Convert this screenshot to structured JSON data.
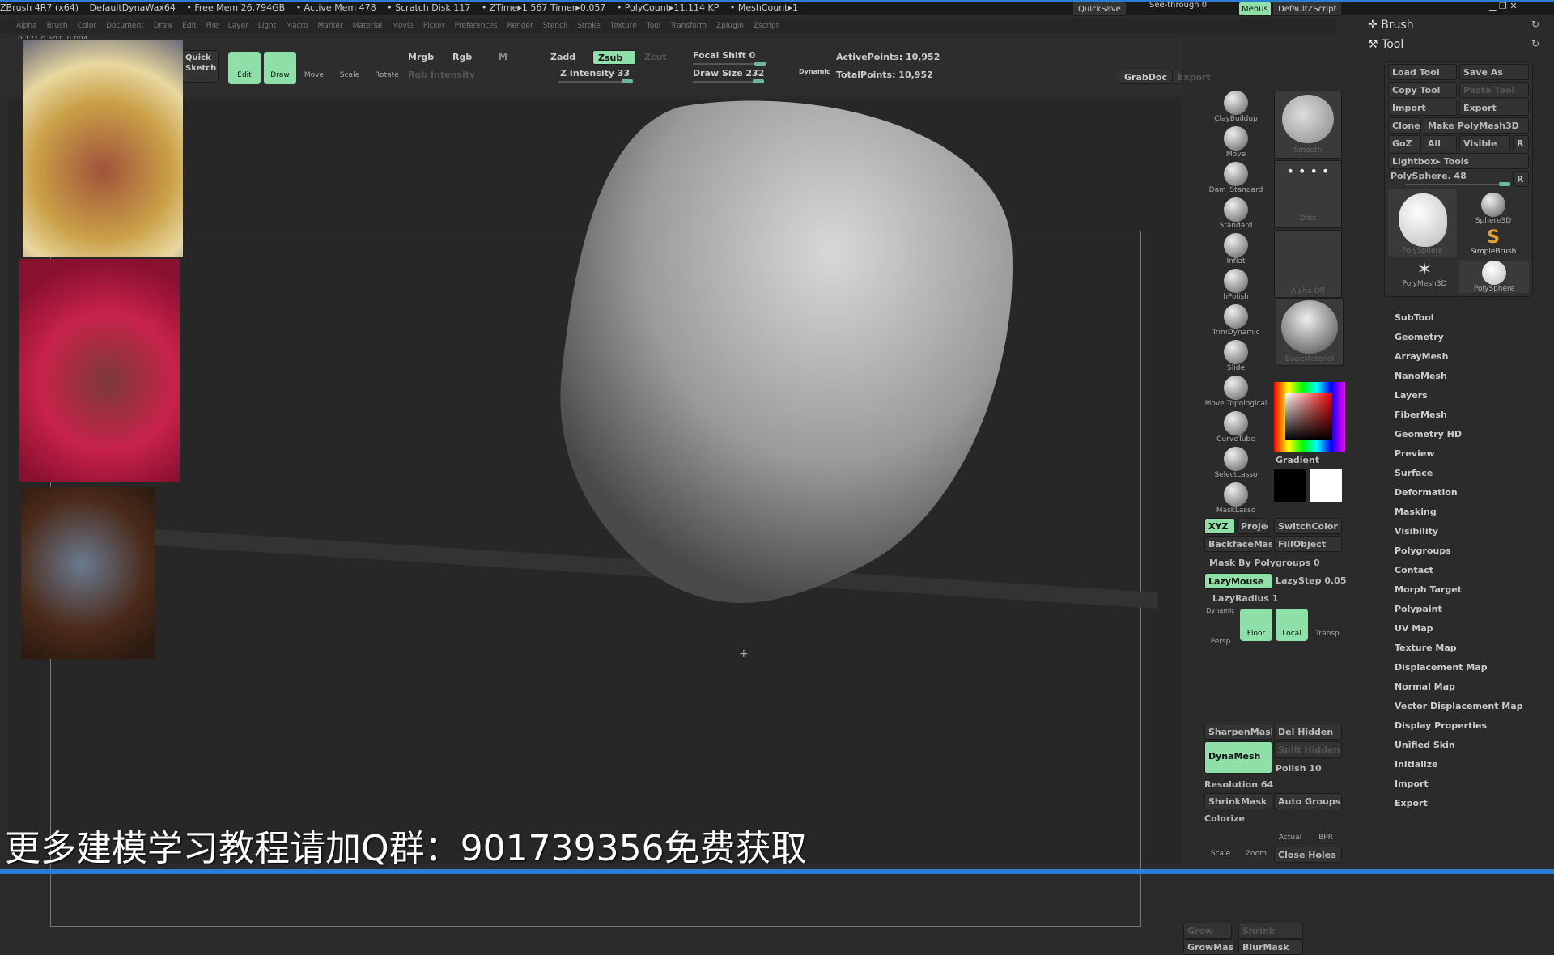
{
  "titlebar": {
    "app": "ZBrush 4R7 (x64)",
    "project": "DefaultDynaWax64",
    "free_mem": "• Free Mem 26.794GB",
    "active_mem": "• Active Mem 478",
    "scratch": "• Scratch Disk 117",
    "ztime": "• ZTime▸1.567 Timer▸0.057",
    "polycount": "• PolyCount▸11.114 KP",
    "meshcount": "• MeshCount▸1",
    "quicksave": "QuickSave",
    "seethrough": "See-through 0",
    "menus": "Menus",
    "zscript": "DefaultZScript"
  },
  "menus": [
    "Alpha",
    "Brush",
    "Color",
    "Document",
    "Draw",
    "Edit",
    "File",
    "Layer",
    "Light",
    "Macro",
    "Marker",
    "Material",
    "Movie",
    "Picker",
    "Preferences",
    "Render",
    "Stencil",
    "Stroke",
    "Texture",
    "Tool",
    "Transform",
    "Zplugin",
    "Zscript"
  ],
  "coords": "0.171 0.507 -0.004",
  "shelf": {
    "quick_sketch": "Quick Sketch",
    "edit": "Edit",
    "draw": "Draw",
    "move": "Move",
    "scale": "Scale",
    "rotate": "Rotate",
    "mrgb": "Mrgb",
    "rgb": "Rgb",
    "m": "M",
    "rgb_intensity": "Rgb Intensity",
    "zadd": "Zadd",
    "zsub": "Zsub",
    "zcut": "Zcut",
    "z_intensity": "Z Intensity 33",
    "focal_shift": "Focal Shift 0",
    "draw_size": "Draw Size 232",
    "dynamic": "Dynamic",
    "active_points": "ActivePoints: 10,952",
    "total_points": "TotalPoints: 10,952",
    "grabdoc": "GrabDoc",
    "export": "Export"
  },
  "slider_values": {
    "focal_shift": 0,
    "draw_size": 232,
    "z_intensity": 33,
    "polysphere": 48,
    "mask_by_polygroups": 0,
    "lazystep": 0.05,
    "lazyradius": 1,
    "polish": 10,
    "resolution": 64
  },
  "brushes": [
    "ClayBuildup",
    "Move",
    "Dam_Standard",
    "Standard",
    "Inflat",
    "hPolish",
    "TrimDynamic",
    "Slide",
    "Move Topological",
    "CurveTube",
    "SelectLasso",
    "MaskLasso"
  ],
  "brush_slots": {
    "stroke": "Smooth",
    "alpha_stroke": "Dots",
    "alpha": "Alpha Off",
    "material": "BasicMaterial",
    "gradient": "Gradient"
  },
  "colors": {
    "accent": "#8fe0a8",
    "main_color": "#000000",
    "secondary_color": "#ffffff",
    "window_border": "#2a7fd4"
  },
  "tray": {
    "xyz": "XYZ",
    "projec": "Projec",
    "switchcolor": "SwitchColor",
    "backfacemask": "BackfaceMask",
    "fillobject": "FillObject",
    "mask_polygroups": "Mask By Polygroups 0",
    "lazymouse": "LazyMouse",
    "lazystep": "LazyStep 0.05",
    "lazyradius": "LazyRadius 1",
    "dynamic": "Dynamic",
    "persp": "Persp",
    "floor": "Floor",
    "local": "Local",
    "transp": "Transp",
    "sharpenmask": "SharpenMask",
    "del_hidden": "Del Hidden",
    "split_hidden": "Split Hidden",
    "dynamesh": "DynaMesh",
    "polish": "Polish 10",
    "resolution": "Resolution 64",
    "shrinkmask": "ShrinkMask",
    "auto_groups": "Auto Groups",
    "colorize": "Colorize",
    "actual": "Actual",
    "bpr": "BPR",
    "scale": "Scale",
    "zoom": "Zoom",
    "close_holes": "Close Holes",
    "grow": "Grow",
    "shrink": "Shrink",
    "growmask": "GrowMask",
    "blurmask": "BlurMask"
  },
  "right": {
    "brush": "Brush",
    "tool": "Tool",
    "load_tool": "Load Tool",
    "save_as": "Save As",
    "copy_tool": "Copy Tool",
    "paste_tool": "Paste Tool",
    "import": "Import",
    "export": "Export",
    "clone": "Clone",
    "make_polymesh": "Make PolyMesh3D",
    "goz": "GoZ",
    "all": "All",
    "visible": "Visible",
    "r": "R",
    "lightbox_tools": "Lightbox▸ Tools",
    "polysphere_slider": "PolySphere. 48",
    "tools": [
      "PolySphere",
      "Sphere3D",
      "SimpleBrush",
      "PolyMesh3D",
      "PolySphere"
    ],
    "subpalettes": [
      "SubTool",
      "Geometry",
      "ArrayMesh",
      "NanoMesh",
      "Layers",
      "FiberMesh",
      "Geometry HD",
      "Preview",
      "Surface",
      "Deformation",
      "Masking",
      "Visibility",
      "Polygroups",
      "Contact",
      "Morph Target",
      "Polypaint",
      "UV Map",
      "Texture Map",
      "Displacement Map",
      "Normal Map",
      "Vector Displacement Map",
      "Display Properties",
      "Unified Skin",
      "Initialize",
      "Import",
      "Export"
    ]
  },
  "subtitle": "更多建模学习教程请加Q群：901739356免费获取"
}
